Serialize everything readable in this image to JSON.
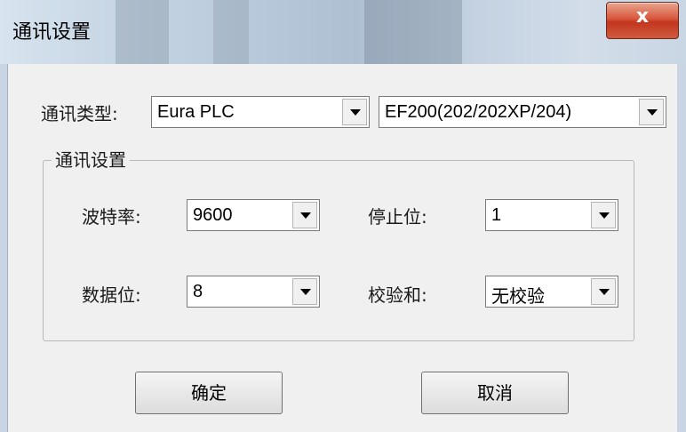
{
  "window": {
    "title": "通讯设置",
    "close_label": "x"
  },
  "comm_type": {
    "label": "通讯类型:",
    "protocol_value": "Eura PLC",
    "model_value": "EF200(202/202XP/204)"
  },
  "group": {
    "title": "通讯设置",
    "baud": {
      "label": "波特率:",
      "value": "9600"
    },
    "stop_bits": {
      "label": "停止位:",
      "value": "1"
    },
    "data_bits": {
      "label": "数据位:",
      "value": "8"
    },
    "checksum": {
      "label": "校验和:",
      "value": "无校验"
    }
  },
  "buttons": {
    "ok": "确定",
    "cancel": "取消"
  }
}
